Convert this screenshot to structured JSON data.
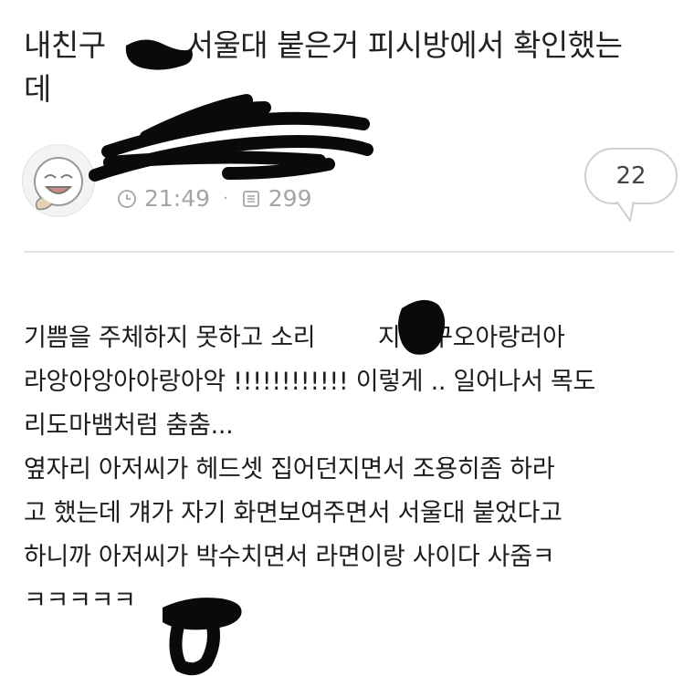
{
  "post": {
    "title_line1": "내친구 ",
    "title_line1_rest": " 서울대 붙은거 피시방에서 확인했는",
    "title_line2": "데",
    "time": "21:49",
    "views": "299",
    "comment_count": "22"
  },
  "body_lines": [
    {
      "a": "기쁨을 주체하지 못하고 소리 ",
      "b": " 지름 꾸오아랑러아"
    },
    {
      "a": "라앙아앙아아랑아악 !!!!!!!!!!!! 이렇게 .. 일어나서 목도",
      "b": ""
    },
    {
      "a": "리도마뱀처럼 춤춤...",
      "b": ""
    },
    {
      "a": "옆자리 아저씨가 헤드셋 집어던지면서 조용히좀 하라",
      "b": ""
    },
    {
      "a": "고 했는데 걔가 자기 화면보여주면서 서울대 붙었다고",
      "b": ""
    },
    {
      "a": "하니까 아저씨가 박수치면서 라면이랑 사이다 사줌ㅋ",
      "b": ""
    },
    {
      "a": "ㅋㅋㅋㅋㅋ",
      "b": ""
    }
  ],
  "icons": {
    "avatar": "cartoon-face-avatar",
    "time": "clock-icon",
    "views": "document-icon",
    "comments": "speech-bubble-icon"
  },
  "colors": {
    "text": "#1d1d1d",
    "meta": "#a5a5a5",
    "divider": "#e4e4e4",
    "redaction": "#0a0a0a"
  }
}
